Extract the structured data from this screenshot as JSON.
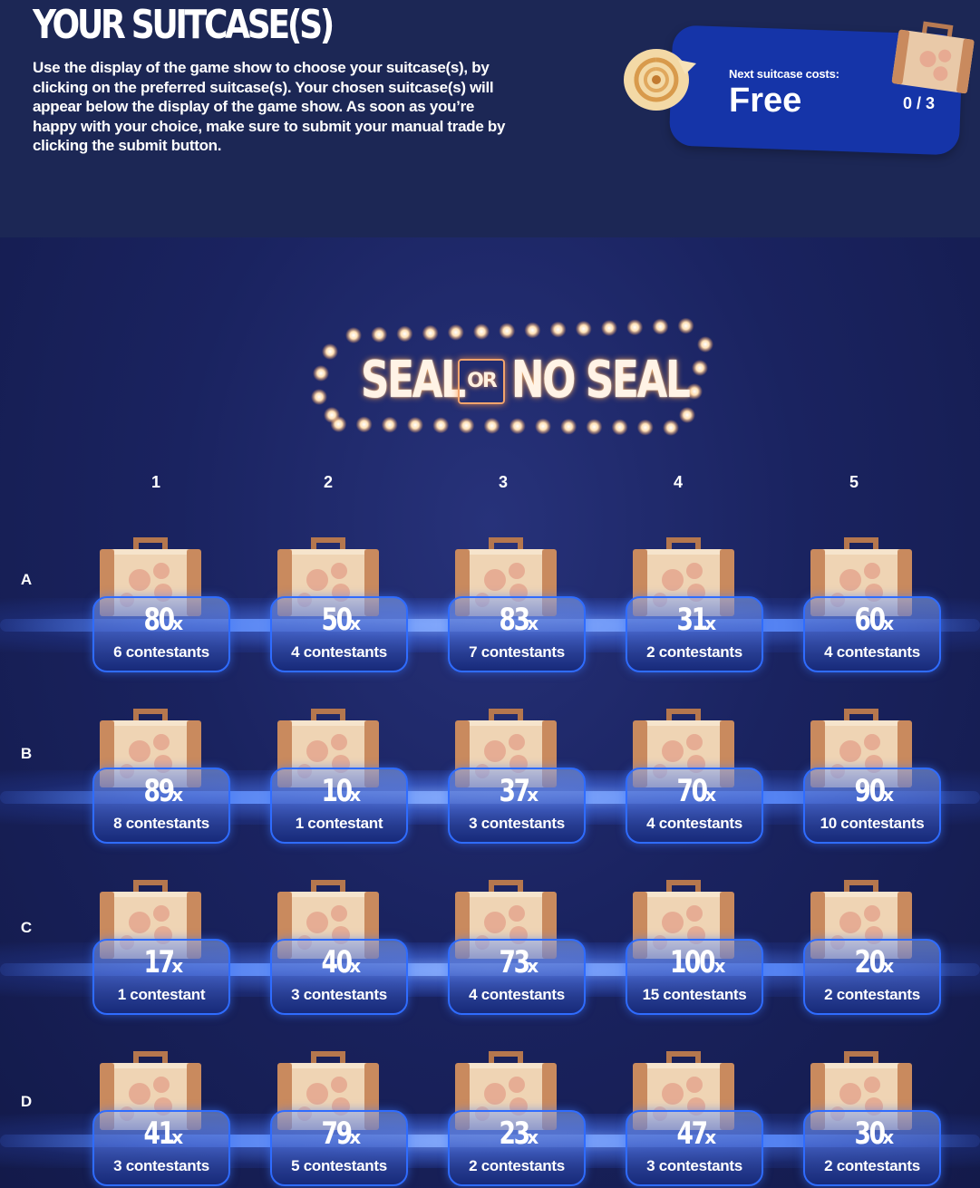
{
  "header": {
    "title": "YOUR SUITCASE(S)",
    "description": "Use the display of the game show to choose your suitcase(s), by clicking on the preferred suitcase(s). Your chosen suitcase(s) will appear below the display of the game show. As soon as you’re happy with your choice, make sure to submit your manual trade by clicking the submit button."
  },
  "cost": {
    "label": "Next suitcase costs:",
    "value": "Free",
    "count": "0 / 3"
  },
  "logo": {
    "left": "SEAL",
    "or": "OR",
    "right": "NO SEAL"
  },
  "columns": [
    "1",
    "2",
    "3",
    "4",
    "5"
  ],
  "rows": [
    "A",
    "B",
    "C",
    "D"
  ],
  "grid": [
    [
      {
        "mult": "80",
        "x": "x",
        "contestants": "6 contestants"
      },
      {
        "mult": "50",
        "x": "x",
        "contestants": "4 contestants"
      },
      {
        "mult": "83",
        "x": "x",
        "contestants": "7 contestants"
      },
      {
        "mult": "31",
        "x": "x",
        "contestants": "2 contestants"
      },
      {
        "mult": "60",
        "x": "x",
        "contestants": "4 contestants"
      }
    ],
    [
      {
        "mult": "89",
        "x": "x",
        "contestants": "8 contestants"
      },
      {
        "mult": "10",
        "x": "x",
        "contestants": "1 contestant"
      },
      {
        "mult": "37",
        "x": "x",
        "contestants": "3 contestants"
      },
      {
        "mult": "70",
        "x": "x",
        "contestants": "4 contestants"
      },
      {
        "mult": "90",
        "x": "x",
        "contestants": "10 contestants"
      }
    ],
    [
      {
        "mult": "17",
        "x": "x",
        "contestants": "1 contestant"
      },
      {
        "mult": "40",
        "x": "x",
        "contestants": "3 contestants"
      },
      {
        "mult": "73",
        "x": "x",
        "contestants": "4 contestants"
      },
      {
        "mult": "100",
        "x": "x",
        "contestants": "15 contestants"
      },
      {
        "mult": "20",
        "x": "x",
        "contestants": "2 contestants"
      }
    ],
    [
      {
        "mult": "41",
        "x": "x",
        "contestants": "3 contestants"
      },
      {
        "mult": "79",
        "x": "x",
        "contestants": "5 contestants"
      },
      {
        "mult": "23",
        "x": "x",
        "contestants": "2 contestants"
      },
      {
        "mult": "47",
        "x": "x",
        "contestants": "3 contestants"
      },
      {
        "mult": "30",
        "x": "x",
        "contestants": "2 contestants"
      }
    ]
  ],
  "colors": {
    "page_bg": "#141c4a",
    "header_bg": "#1c2755",
    "panel_blue": "#1534a8",
    "plate_border": "#2f6cff",
    "bulb_glow": "#ffb36b"
  },
  "icons": {
    "shell": "seashell-icon",
    "suitcase": "suitcase-icon"
  }
}
